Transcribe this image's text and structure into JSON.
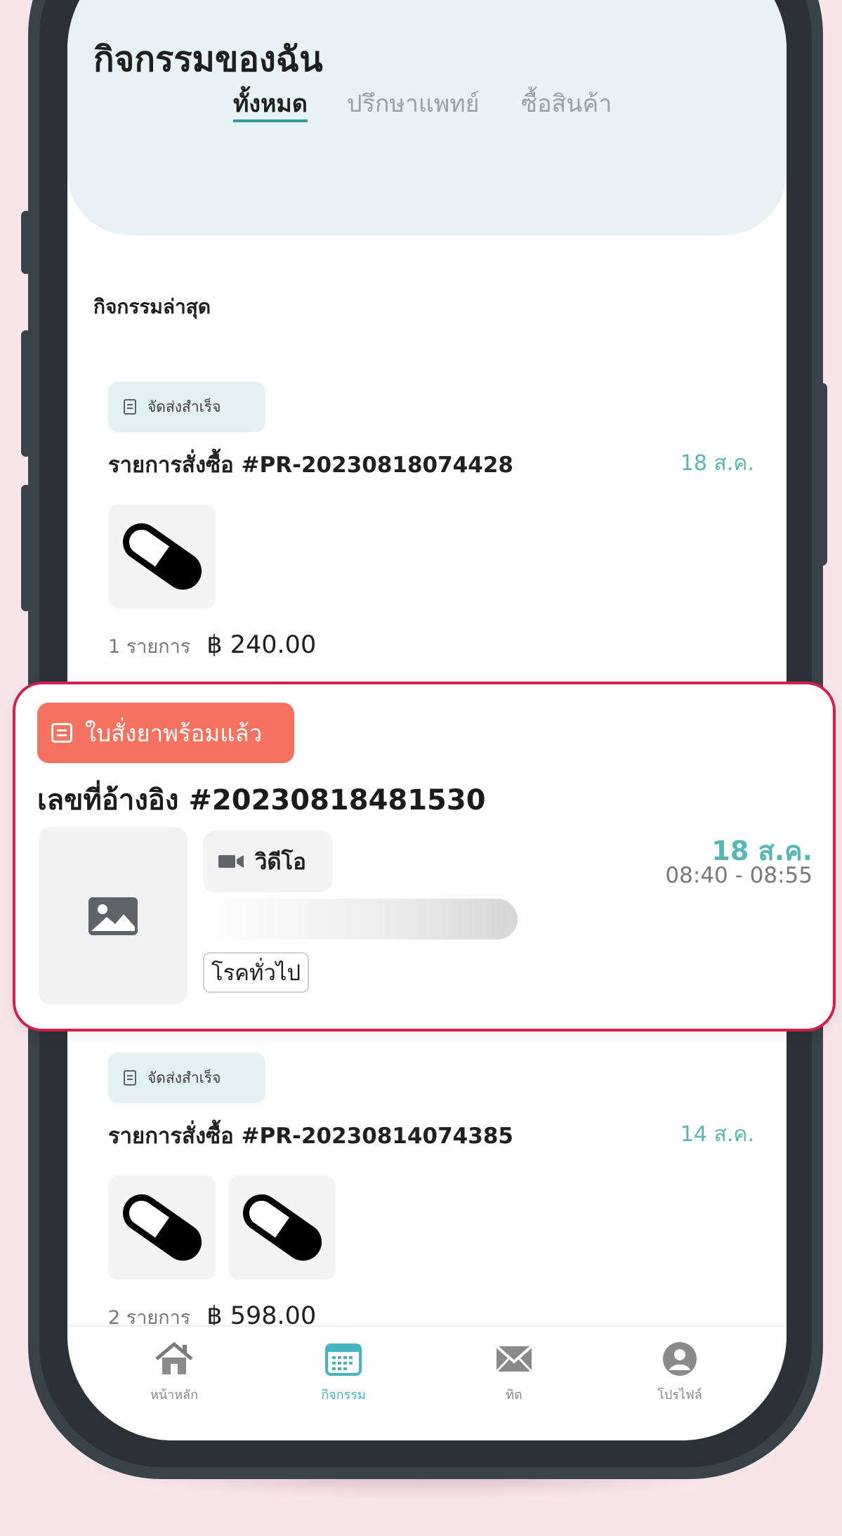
{
  "header": {
    "title": "กิจกรรมของฉัน",
    "tabs": [
      {
        "label": "ทั้งหมด",
        "active": true
      },
      {
        "label": "ปรึกษาแพทย์",
        "active": false
      },
      {
        "label": "ซื้อสินค้า",
        "active": false
      }
    ]
  },
  "section_title": "กิจกรรมล่าสุด",
  "orders": [
    {
      "status": "จัดส่งสำเร็จ",
      "number": "รายการสั่งซื้อ #PR-20230818074428",
      "date": "18 ส.ค.",
      "item_icons": [
        "pill-capsule-icon"
      ],
      "count": "1 รายการ",
      "total": "฿ 240.00"
    },
    {
      "status": "จัดส่งสำเร็จ",
      "number": "รายการสั่งซื้อ #PR-20230814074385",
      "date": "14 ส.ค.",
      "item_icons": [
        "pill-capsule-icon",
        "pill-capsule-icon"
      ],
      "count": "2 รายการ",
      "total": "฿ 598.00"
    }
  ],
  "consultation": {
    "status": "ใบสั่งยาพร้อมแล้ว",
    "reference": "เลขที่อ้างอิง #20230818481530",
    "type": "วิดีโอ",
    "category": "โรคทั่วไป",
    "date": "18 ส.ค.",
    "time": "08:40 - 08:55"
  },
  "bottom_nav": [
    {
      "label": "หน้าหลัก",
      "icon": "home-icon",
      "active": false
    },
    {
      "label": "กิจกรรม",
      "icon": "calendar-icon",
      "active": true
    },
    {
      "label": "ทิด",
      "icon": "mail-icon",
      "active": false
    },
    {
      "label": "โปรไฟล์",
      "icon": "profile-icon",
      "active": false
    }
  ],
  "colors": {
    "accent": "#5ab5b5",
    "highlight_border": "#d21f4e",
    "rx_chip": "#f4725f",
    "header_bg": "#e6f2f3",
    "page_bg": "#f9e6ea"
  }
}
